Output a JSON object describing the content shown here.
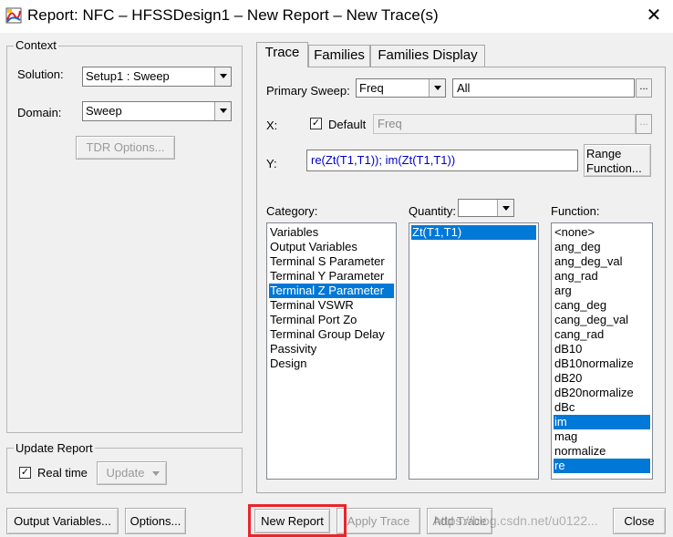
{
  "window": {
    "title": "Report: NFC – HFSSDesign1 – New Report – New Trace(s)",
    "close_glyph": "✕"
  },
  "context": {
    "group_title": "Context",
    "solution_label": "Solution:",
    "solution_value": "Setup1 : Sweep",
    "domain_label": "Domain:",
    "domain_value": "Sweep",
    "tdr_button": "TDR Options..."
  },
  "update_report": {
    "group_title": "Update Report",
    "realtime_label": "Real time",
    "realtime_checked": true,
    "update_button": "Update"
  },
  "tabs": [
    {
      "label": "Trace",
      "active": true
    },
    {
      "label": "Families",
      "active": false
    },
    {
      "label": "Families Display",
      "active": false
    }
  ],
  "trace": {
    "primary_sweep_label": "Primary Sweep:",
    "primary_sweep_value": "Freq",
    "primary_sweep_range": "All",
    "x_label": "X:",
    "default_label": "Default",
    "default_checked": true,
    "x_value": "Freq",
    "y_label": "Y:",
    "y_expression": "re(Zt(T1,T1)); im(Zt(T1,T1))",
    "range_function_button": "Range Function...",
    "ellipsis": "..."
  },
  "category": {
    "label": "Category:",
    "items": [
      {
        "text": "Variables",
        "selected": false
      },
      {
        "text": "Output Variables",
        "selected": false
      },
      {
        "text": "Terminal S Parameter",
        "selected": false
      },
      {
        "text": "Terminal Y Parameter",
        "selected": false
      },
      {
        "text": "Terminal Z Parameter",
        "selected": true
      },
      {
        "text": "Terminal VSWR",
        "selected": false
      },
      {
        "text": "Terminal Port Zo",
        "selected": false
      },
      {
        "text": "Terminal Group Delay",
        "selected": false
      },
      {
        "text": "Passivity",
        "selected": false
      },
      {
        "text": "Design",
        "selected": false
      }
    ]
  },
  "quantity": {
    "label": "Quantity:",
    "filter_value": "",
    "items": [
      {
        "text": "Zt(T1,T1)",
        "selected": true
      }
    ]
  },
  "function": {
    "label": "Function:",
    "items": [
      {
        "text": "<none>",
        "selected": false
      },
      {
        "text": "ang_deg",
        "selected": false
      },
      {
        "text": "ang_deg_val",
        "selected": false
      },
      {
        "text": "ang_rad",
        "selected": false
      },
      {
        "text": "arg",
        "selected": false
      },
      {
        "text": "cang_deg",
        "selected": false
      },
      {
        "text": "cang_deg_val",
        "selected": false
      },
      {
        "text": "cang_rad",
        "selected": false
      },
      {
        "text": "dB10",
        "selected": false
      },
      {
        "text": "dB10normalize",
        "selected": false
      },
      {
        "text": "dB20",
        "selected": false
      },
      {
        "text": "dB20normalize",
        "selected": false
      },
      {
        "text": "dBc",
        "selected": false
      },
      {
        "text": "im",
        "selected": true
      },
      {
        "text": "mag",
        "selected": false
      },
      {
        "text": "normalize",
        "selected": false
      },
      {
        "text": "re",
        "selected": true
      }
    ]
  },
  "bottom": {
    "output_variables_button": "Output Variables...",
    "options_button": "Options...",
    "new_report_button": "New Report",
    "apply_trace_button": "Apply Trace",
    "add_trace_button": "Add Trace",
    "close_button": "Close",
    "watermark": "https://blog.csdn.net/u0122..."
  },
  "colors": {
    "selection": "#0078d7",
    "highlight": "#e8252b",
    "expression_text": "#0000cc"
  }
}
